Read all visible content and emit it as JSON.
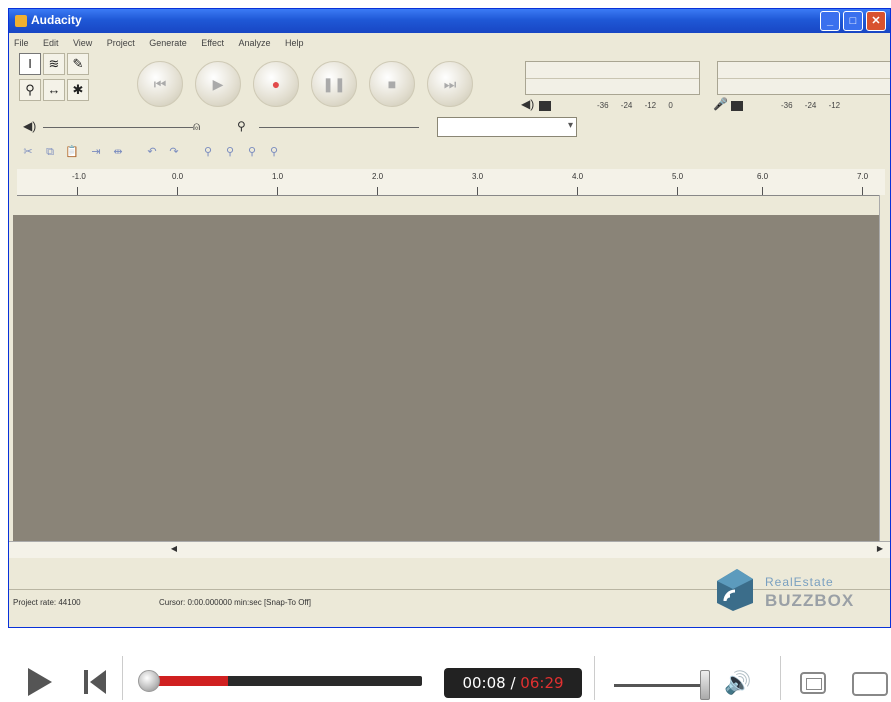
{
  "window": {
    "title": "Audacity"
  },
  "menu": [
    "File",
    "Edit",
    "View",
    "Project",
    "Generate",
    "Effect",
    "Analyze",
    "Help"
  ],
  "meters": {
    "play_ticks": "-36 -24 -12 0",
    "rec_ticks": "-36 -24 -12"
  },
  "ruler": {
    "labels": [
      "-1.0",
      "0.0",
      "1.0",
      "2.0",
      "3.0",
      "4.0",
      "5.0",
      "6.0",
      "7.0"
    ]
  },
  "status": {
    "project_rate": "Project rate:  44100",
    "cursor": "Cursor: 0:00.000000 min:sec   [Snap-To Off]"
  },
  "watermark": {
    "top": "RealEstate",
    "bottom": "BUZZBOX"
  },
  "player": {
    "time_current": "00:08",
    "time_separator": " / ",
    "time_total": "06:29",
    "progress_fraction": 0.28
  }
}
